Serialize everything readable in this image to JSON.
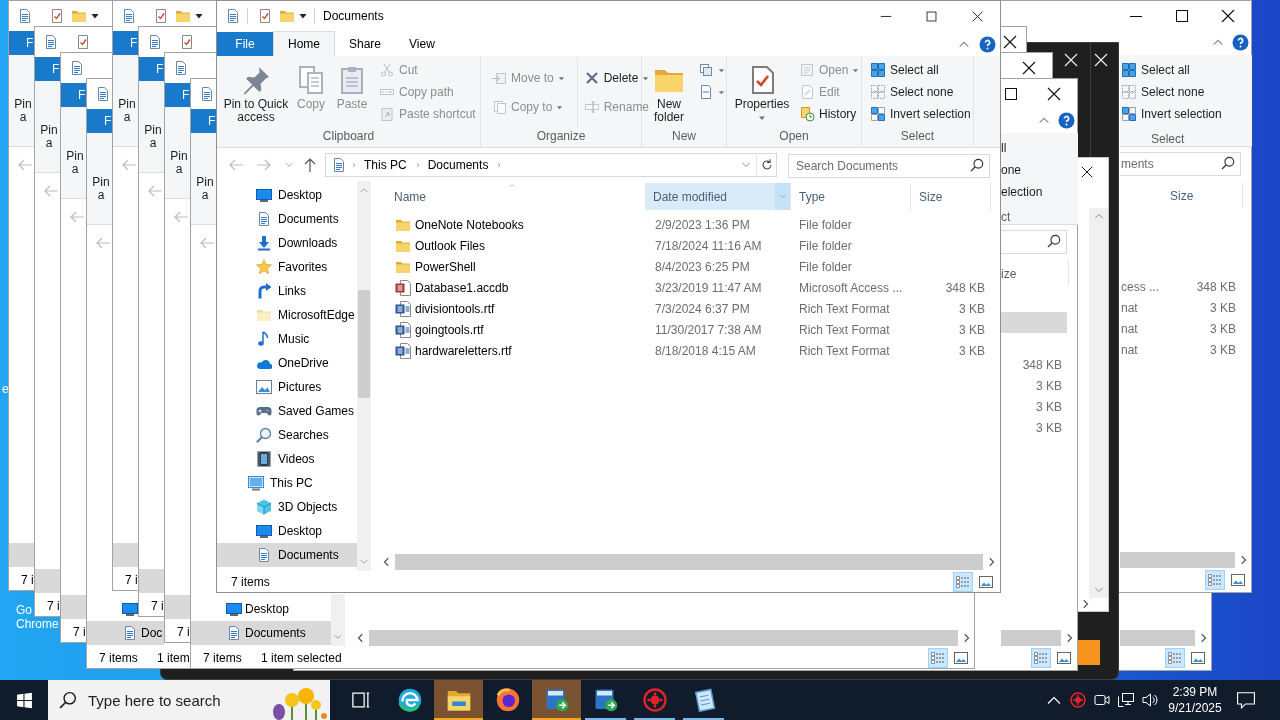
{
  "desktop": {
    "icon_labels": [
      {
        "lines": [
          "e"
        ]
      },
      {
        "lines": [
          "Go",
          "Chrome"
        ]
      }
    ]
  },
  "background_windows": [
    {
      "kind": "explorer",
      "view_buttons": [
        {
          "kind": "details",
          "selected": true
        },
        {
          "kind": "large-icons",
          "selected": false
        }
      ]
    },
    {
      "kind": "explorer",
      "title_controls": [
        {
          "kind": "minimize"
        },
        {
          "kind": "maximize"
        },
        {
          "kind": "close"
        }
      ],
      "ribbon_controls": [
        {
          "kind": "collapse"
        },
        {
          "kind": "help"
        }
      ],
      "select_group": {
        "commands": [
          {
            "label": "Select all"
          },
          {
            "label": "Select none"
          },
          {
            "label": "Invert selection"
          }
        ],
        "label": "Select"
      },
      "search_box": {
        "kind": "search",
        "placeholder": "ments"
      },
      "size_header": "Size",
      "rows": [
        {
          "type": "cess ...",
          "size": "348 KB",
          "selected": false
        },
        {
          "type": "nat",
          "size": "3 KB",
          "selected": false
        },
        {
          "type": "nat",
          "size": "3 KB",
          "selected": false
        },
        {
          "type": "nat",
          "size": "3 KB",
          "selected": false
        }
      ],
      "view_buttons": [
        {
          "kind": "details",
          "selected": true
        },
        {
          "kind": "large-icons",
          "selected": false
        }
      ]
    },
    {
      "kind": "dark",
      "accent_tile": true
    },
    {
      "kind": "dark"
    },
    {
      "kind": "explorer",
      "title_controls": [
        {
          "kind": "close"
        }
      ]
    },
    {
      "kind": "explorer",
      "title_controls": [
        {
          "kind": "close"
        }
      ]
    },
    {
      "kind": "dialog"
    },
    {
      "kind": "explorer",
      "title_controls": [
        {
          "kind": "maximize"
        },
        {
          "kind": "close"
        }
      ],
      "ribbon_controls": [
        {
          "kind": "collapse"
        },
        {
          "kind": "help"
        }
      ],
      "select_group": {
        "commands": [
          {
            "label": "ll"
          },
          {
            "label": "one"
          },
          {
            "label": "election"
          }
        ],
        "label": "ct"
      },
      "search_box": {
        "kind": "search"
      },
      "size_header": "ize",
      "rows": [
        {
          "selected": true
        },
        {
          "size": "348 KB",
          "selected": false
        },
        {
          "size": "3 KB",
          "selected": false
        },
        {
          "size": "3 KB",
          "selected": false
        },
        {
          "size": "3 KB",
          "selected": false
        }
      ],
      "view_buttons": [
        {
          "kind": "details",
          "selected": true
        },
        {
          "kind": "large-icons",
          "selected": false
        }
      ]
    },
    {
      "kind": "explorer",
      "file_tab": "F",
      "pin_label": [
        "Pin",
        "a"
      ],
      "nav_items": [
        {
          "selected": true
        }
      ],
      "status": [
        "7 i"
      ]
    },
    {
      "kind": "explorer",
      "file_tab": "F",
      "pin_label": [
        "Pin",
        "a"
      ],
      "nav_items": [
        {
          "selected": true
        }
      ],
      "status": [
        "7 i"
      ]
    },
    {
      "kind": "explorer",
      "file_tab": "F",
      "pin_label": [
        "Pin",
        "a"
      ],
      "nav_items": [
        {
          "selected": true
        }
      ],
      "status": [
        "7 i"
      ]
    },
    {
      "kind": "explorer",
      "file_tab": "F",
      "pin_label": [
        "Pin",
        "a"
      ],
      "nav_items": [
        {
          "kind": "desktop",
          "selected": false
        },
        {
          "kind": "documents",
          "label": "Doc",
          "selected": true
        }
      ],
      "status": [
        "7 items",
        "1 item"
      ]
    },
    {
      "kind": "explorer",
      "file_tab": "F",
      "pin_label": [
        "Pin",
        "a"
      ],
      "nav_items": [
        {
          "selected": true
        }
      ],
      "status": [
        "7 i"
      ]
    },
    {
      "kind": "explorer",
      "file_tab": "F",
      "pin_label": [
        "Pin",
        "a"
      ],
      "nav_items": [
        {
          "selected": true
        }
      ],
      "status": [
        "7 i"
      ]
    },
    {
      "kind": "explorer",
      "file_tab": "F",
      "pin_label": [
        "Pin",
        "a"
      ],
      "nav_items": [
        {
          "selected": true
        }
      ],
      "status": [
        "7 i"
      ]
    },
    {
      "kind": "explorer",
      "file_tab": "F",
      "pin_label": [
        "Pin",
        "a"
      ],
      "nav_items": [
        {
          "kind": "desktop",
          "label": "Desktop",
          "selected": false
        },
        {
          "kind": "documents",
          "label": "Documents",
          "selected": true
        }
      ],
      "status": [
        "7 items",
        "1 item selected"
      ],
      "view_buttons": [
        {
          "kind": "details",
          "selected": true
        },
        {
          "kind": "large-icons",
          "selected": false
        }
      ]
    }
  ],
  "window": {
    "title": "Documents",
    "file_menu": "File",
    "ribbon_tabs": [
      {
        "label": "Home",
        "selected": true
      },
      {
        "label": "Share",
        "selected": false
      },
      {
        "label": "View",
        "selected": false
      }
    ],
    "ribbon_groups": [
      {
        "label": "Clipboard",
        "kind": "stack",
        "commands": [
          {
            "label": "Pin to Quick access",
            "kind": "large",
            "disabled": false
          },
          {
            "label": "Copy",
            "kind": "large",
            "disabled": true
          },
          {
            "label": "Paste",
            "kind": "large",
            "disabled": true
          },
          {
            "label": "Cut",
            "kind": "small",
            "disabled": true
          },
          {
            "label": "Copy path",
            "kind": "small",
            "disabled": true
          },
          {
            "label": "Paste shortcut",
            "kind": "small",
            "disabled": true
          }
        ]
      },
      {
        "label": "Organize",
        "kind": "pairs",
        "commands": [
          {
            "label": "Move to",
            "kind": "small",
            "menu": true,
            "disabled": true
          },
          {
            "label": "Copy to",
            "kind": "small",
            "menu": true,
            "disabled": true
          },
          {
            "label": "Delete",
            "kind": "small",
            "menu": true,
            "disabled": false
          },
          {
            "label": "Rename",
            "kind": "small",
            "disabled": true
          }
        ]
      },
      {
        "label": "New",
        "kind": "stack",
        "commands": [
          {
            "label": "New folder",
            "kind": "large",
            "disabled": false
          },
          {
            "kind": "icon",
            "menu": true,
            "disabled": false
          },
          {
            "kind": "icon",
            "menu": true,
            "disabled": false
          }
        ]
      },
      {
        "label": "Open",
        "kind": "stack",
        "commands": [
          {
            "label": "Properties",
            "kind": "large",
            "menu": true,
            "disabled": false
          },
          {
            "label": "Open",
            "kind": "small",
            "menu": true,
            "disabled": true
          },
          {
            "label": "Edit",
            "kind": "small",
            "disabled": true
          },
          {
            "label": "History",
            "kind": "small",
            "disabled": false
          }
        ]
      },
      {
        "label": "Select",
        "kind": "stack",
        "commands": [
          {
            "label": "Select all",
            "kind": "small",
            "disabled": false
          },
          {
            "label": "Select none",
            "kind": "small",
            "disabled": false
          },
          {
            "label": "Invert selection",
            "kind": "small",
            "disabled": false
          }
        ]
      }
    ],
    "address_bar": {
      "crumbs": [
        "This PC",
        "Documents"
      ]
    },
    "search_box": {
      "placeholder": "Search Documents"
    },
    "nav_pane": {
      "tree": [
        {
          "children": [
            {
              "label": "Desktop",
              "kind": "desktop",
              "selected": false
            },
            {
              "label": "Documents",
              "kind": "documents",
              "selected": false
            },
            {
              "label": "Downloads",
              "kind": "downloads",
              "selected": false
            },
            {
              "label": "Favorites",
              "kind": "favorites",
              "selected": false
            },
            {
              "label": "Links",
              "kind": "links",
              "selected": false
            },
            {
              "label": "MicrosoftEdge",
              "kind": "folder",
              "selected": false
            },
            {
              "label": "Music",
              "kind": "music",
              "selected": false
            },
            {
              "label": "OneDrive",
              "kind": "onedrive",
              "selected": false
            },
            {
              "label": "Pictures",
              "kind": "pictures",
              "selected": false
            },
            {
              "label": "Saved Games",
              "kind": "games",
              "selected": false
            },
            {
              "label": "Searches",
              "kind": "searches",
              "selected": false
            },
            {
              "label": "Videos",
              "kind": "videos",
              "selected": false
            }
          ]
        },
        {
          "label": "This PC",
          "kind": "pc",
          "selected": false,
          "children": [
            {
              "label": "3D Objects",
              "kind": "objects",
              "selected": false
            },
            {
              "label": "Desktop",
              "kind": "desktop",
              "selected": false
            },
            {
              "label": "Documents",
              "kind": "documents",
              "selected": true
            }
          ]
        }
      ]
    },
    "file_list": {
      "columns": [
        {
          "label": "Name",
          "sorted": true,
          "highlighted": false
        },
        {
          "label": "Date modified",
          "sorted": false,
          "highlighted": true
        },
        {
          "label": "Type",
          "sorted": false,
          "highlighted": false
        },
        {
          "label": "Size",
          "sorted": false,
          "highlighted": false
        }
      ],
      "rows": [
        {
          "name": "OneNote Notebooks",
          "kind": "folder",
          "date": "2/9/2023 1:36 PM",
          "type": "File folder",
          "selected": false
        },
        {
          "name": "Outlook Files",
          "kind": "folder",
          "date": "7/18/2024 11:16 AM",
          "type": "File folder",
          "selected": false
        },
        {
          "name": "PowerShell",
          "kind": "folder",
          "date": "8/4/2023 6:25 PM",
          "type": "File folder",
          "selected": false
        },
        {
          "name": "Database1.accdb",
          "kind": "access",
          "date": "3/23/2019 11:47 AM",
          "type": "Microsoft Access ...",
          "size": "348 KB",
          "selected": false
        },
        {
          "name": "divisiontools.rtf",
          "kind": "word",
          "date": "7/3/2024 6:37 PM",
          "type": "Rich Text Format",
          "size": "3 KB",
          "selected": false
        },
        {
          "name": "goingtools.rtf",
          "kind": "word",
          "date": "11/30/2017 7:38 AM",
          "type": "Rich Text Format",
          "size": "3 KB",
          "selected": false
        },
        {
          "name": "hardwareletters.rtf",
          "kind": "word",
          "date": "8/18/2018 4:15 AM",
          "type": "Rich Text Format",
          "size": "3 KB",
          "selected": false
        }
      ]
    },
    "status_bar": {
      "text": "7 items",
      "view_buttons": [
        {
          "kind": "details",
          "selected": true
        },
        {
          "kind": "large-icons",
          "selected": false
        }
      ]
    }
  },
  "taskbar": {
    "search_placeholder": "Type here to search",
    "buttons": [
      {
        "kind": "task-view",
        "highlighted": false,
        "running": false
      },
      {
        "kind": "edge",
        "highlighted": false,
        "running": false
      },
      {
        "kind": "explorer",
        "highlighted": true,
        "running": true
      },
      {
        "kind": "firefox",
        "highlighted": false,
        "running": false
      },
      {
        "kind": "app",
        "highlighted": true,
        "running": true
      },
      {
        "kind": "app",
        "highlighted": false,
        "running": true
      },
      {
        "kind": "gear",
        "highlighted": false,
        "running": true
      },
      {
        "kind": "notepad",
        "highlighted": false,
        "running": true
      }
    ],
    "tray": [
      {
        "kind": "chevron"
      },
      {
        "kind": "gear"
      },
      {
        "kind": "camera"
      },
      {
        "kind": "network"
      },
      {
        "kind": "volume"
      }
    ],
    "clock": {
      "time": "2:39 PM",
      "date": "9/21/2025"
    }
  }
}
